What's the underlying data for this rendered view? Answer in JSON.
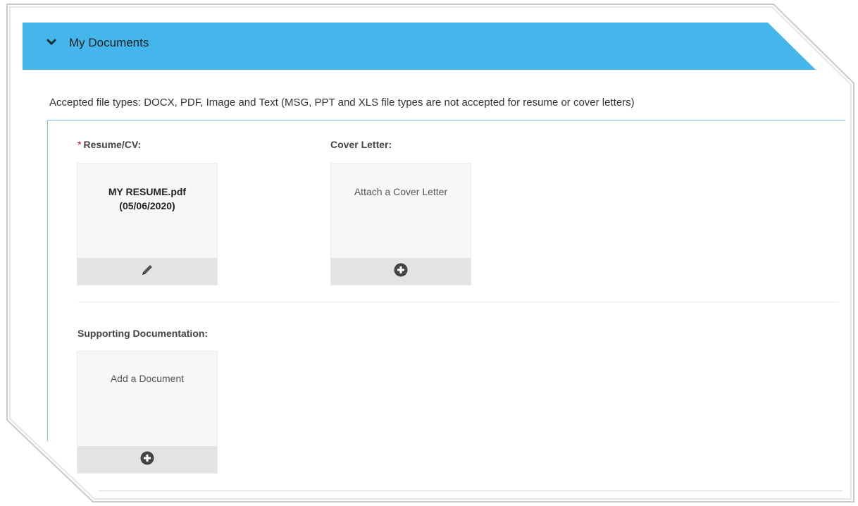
{
  "section": {
    "title": "My Documents",
    "accent_color": "#44b6eb",
    "accepted_note": "Accepted file types: DOCX, PDF, Image and Text (MSG, PPT and XLS file types are not accepted for resume or cover letters)"
  },
  "resume": {
    "required_mark": "*",
    "label": "Resume/CV:",
    "file_name": "MY RESUME.pdf",
    "file_date": "(05/06/2020)",
    "action_icon": "pencil-icon"
  },
  "cover_letter": {
    "label": "Cover Letter:",
    "prompt": "Attach a Cover Letter",
    "action_icon": "plus-circle-icon"
  },
  "supporting": {
    "label": "Supporting Documentation:",
    "prompt": "Add a Document",
    "action_icon": "plus-circle-icon"
  }
}
